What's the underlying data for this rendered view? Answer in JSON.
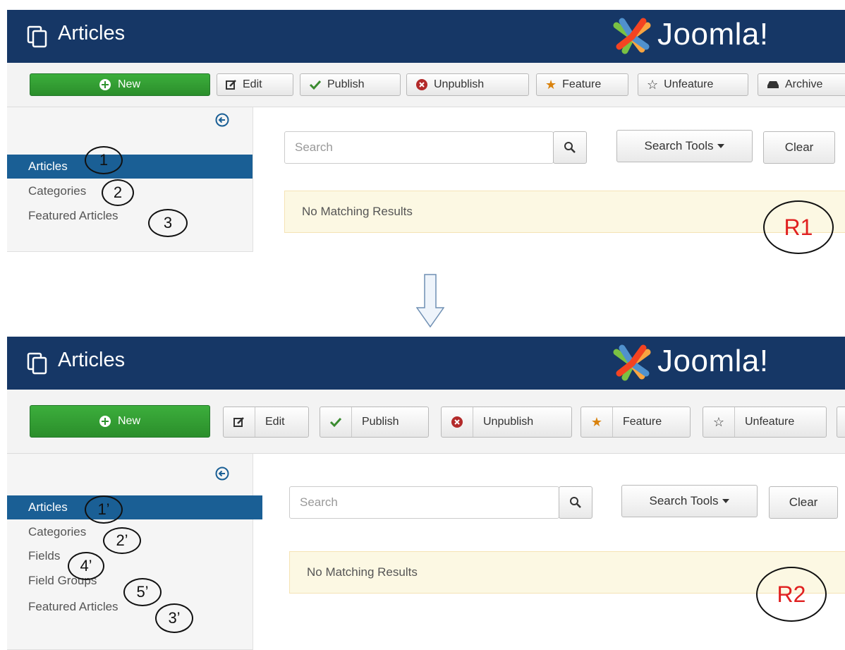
{
  "panels": [
    {
      "header": {
        "title": "Articles",
        "brand": "Joomla!"
      },
      "toolbar": {
        "new": "New",
        "edit": "Edit",
        "publish": "Publish",
        "unpublish": "Unpublish",
        "feature": "Feature",
        "unfeature": "Unfeature",
        "archive": "Archive"
      },
      "sidebar": [
        {
          "label": "Articles",
          "marker": "1"
        },
        {
          "label": "Categories",
          "marker": "2"
        },
        {
          "label": "Featured Articles",
          "marker": "3"
        }
      ],
      "search": {
        "placeholder": "Search",
        "tools": "Search Tools",
        "clear": "Clear"
      },
      "message": "No Matching Results",
      "region_label": "R1"
    },
    {
      "header": {
        "title": "Articles",
        "brand": "Joomla!"
      },
      "toolbar": {
        "new": "New",
        "edit": "Edit",
        "publish": "Publish",
        "unpublish": "Unpublish",
        "feature": "Feature",
        "unfeature": "Unfeature"
      },
      "sidebar": [
        {
          "label": "Articles",
          "marker": "1’"
        },
        {
          "label": "Categories",
          "marker": "2’"
        },
        {
          "label": "Fields",
          "marker": "4’"
        },
        {
          "label": "Field Groups",
          "marker": "5’"
        },
        {
          "label": "Featured Articles",
          "marker": "3’"
        }
      ],
      "search": {
        "placeholder": "Search",
        "tools": "Search Tools",
        "clear": "Clear"
      },
      "message": "No Matching Results",
      "region_label": "R2"
    }
  ],
  "colors": {
    "header_bg": "#163766",
    "active_nav": "#1a5f95",
    "new_button": "#2e932e",
    "alert_bg": "#fcf8e3",
    "annotation_red": "#e02020"
  },
  "icons": [
    "copy-icon",
    "joomla-logo-icon",
    "plus-circle-icon",
    "edit-icon",
    "check-icon",
    "x-circle-icon",
    "star-icon",
    "star-outline-icon",
    "archive-icon",
    "collapse-arrow-icon",
    "search-icon",
    "down-arrow-icon"
  ]
}
